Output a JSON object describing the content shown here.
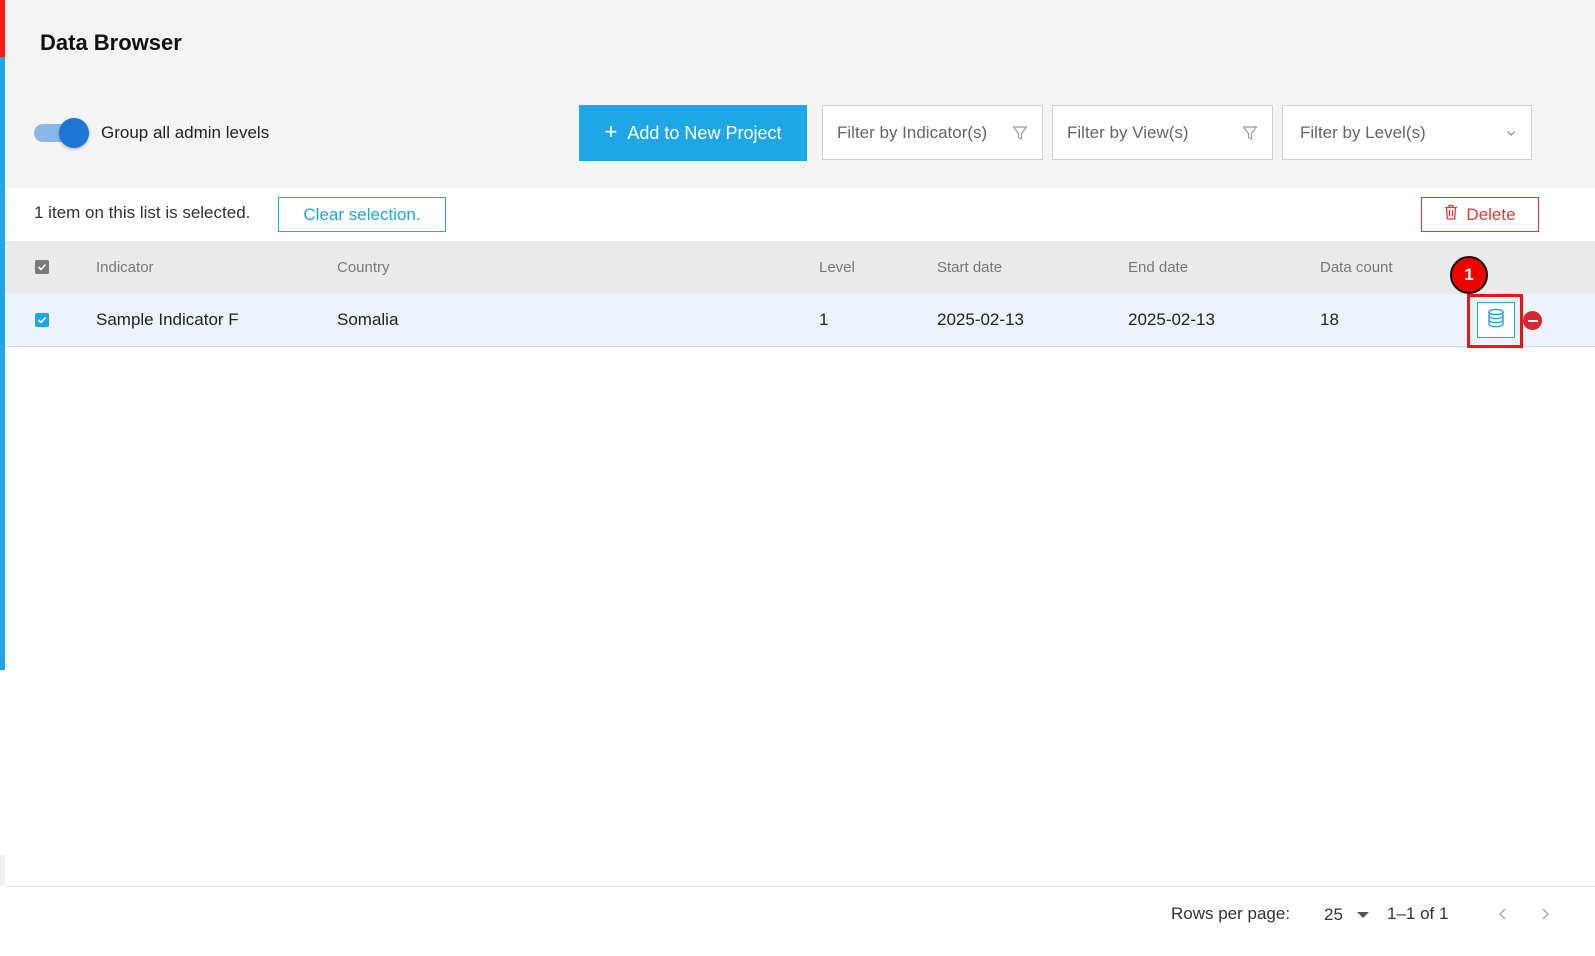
{
  "page": {
    "title": "Data Browser"
  },
  "toolbar": {
    "toggle_label": "Group all admin levels",
    "toggle_on": true,
    "add_button": "Add to New Project",
    "filter_indicator": "Filter by Indicator(s)",
    "filter_view": "Filter by View(s)",
    "filter_level": "Filter by Level(s)"
  },
  "selection": {
    "text": "1 item on this list is selected.",
    "clear_label": "Clear selection.",
    "delete_label": "Delete"
  },
  "table": {
    "columns": [
      "Indicator",
      "Country",
      "Level",
      "Start date",
      "End date",
      "Data count"
    ],
    "rows": [
      {
        "indicator": "Sample Indicator F",
        "country": "Somalia",
        "level": "1",
        "start_date": "2025-02-13",
        "end_date": "2025-02-13",
        "data_count": "18",
        "selected": true
      }
    ]
  },
  "annotation": {
    "marker": "1"
  },
  "pagination": {
    "rows_per_page_label": "Rows per page:",
    "rows_per_page": "25",
    "range": "1–1 of 1"
  },
  "colors": {
    "accent": "#1ea7e4",
    "danger": "#e53935",
    "highlight": "#e8141a",
    "toggle": "#1f76d2"
  },
  "icons": [
    "plus-icon",
    "filter-icon",
    "chevron-down-icon",
    "trash-icon",
    "check-icon",
    "database-icon",
    "remove-icon",
    "chevron-left-icon",
    "chevron-right-icon"
  ]
}
